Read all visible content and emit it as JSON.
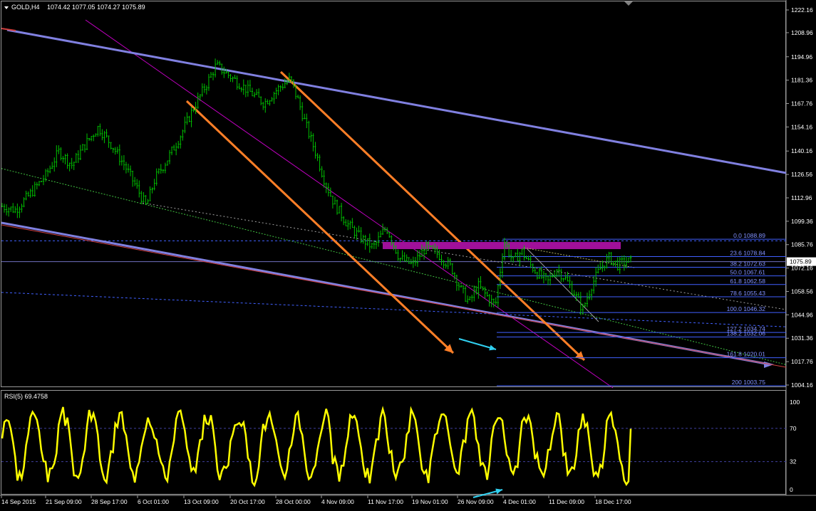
{
  "header": {
    "symbol_label": "GOLD,H4",
    "ohlc": "1074.42 1077.05 1074.27 1075.89"
  },
  "rsi": {
    "label": "RSI(5) 69.4758",
    "levels": [
      100,
      70,
      32,
      0
    ],
    "level_labels": [
      "100",
      "70",
      "32",
      "0"
    ]
  },
  "colors": {
    "background": "#000000",
    "candles": "#00c000",
    "channel": "#8080e0",
    "orange": "#ff7f27",
    "magenta": "#c000c0",
    "fib": "#4060ff",
    "rsi": "#ffff00",
    "cyan_arrow": "#30d0f0",
    "resistance_zone": "#a0109a",
    "price_label_bg": "#ffffff"
  },
  "chart_data": {
    "type": "candlestick",
    "symbol": "GOLD",
    "timeframe": "H4",
    "current_price": 1075.89,
    "current_price_label": "1075.89",
    "price_axis": [
      1222.16,
      1208.96,
      1194.96,
      1181.36,
      1167.76,
      1154.16,
      1140.16,
      1126.56,
      1112.96,
      1099.36,
      1085.76,
      1072.16,
      1058.56,
      1044.96,
      1031.36,
      1017.76,
      1004.16
    ],
    "price_axis_labels": [
      "1222.16",
      "1208.96",
      "1194.96",
      "1181.36",
      "1167.76",
      "1154.16",
      "1140.16",
      "1126.56",
      "1112.96",
      "1099.36",
      "1085.76",
      "1072.16",
      "1058.56",
      "1044.96",
      "1031.36",
      "1017.76",
      "1004.16"
    ],
    "ylim": [
      1002,
      1226
    ],
    "time_axis": [
      "14 Sep 2015",
      "21 Sep 09:00",
      "28 Sep 17:00",
      "6 Oct 01:00",
      "13 Oct 09:00",
      "20 Oct 17:00",
      "28 Oct 00:00",
      "4 Nov 09:00",
      "11 Nov 17:00",
      "19 Nov 01:00",
      "26 Nov 09:00",
      "4 Dec 01:00",
      "11 Dec 09:00",
      "18 Dec 17:00"
    ],
    "price_path": [
      [
        0,
        1108
      ],
      [
        3,
        1106
      ],
      [
        6,
        1114
      ],
      [
        10,
        1126
      ],
      [
        13,
        1140
      ],
      [
        16,
        1132
      ],
      [
        19,
        1144
      ],
      [
        22,
        1154
      ],
      [
        25,
        1144
      ],
      [
        28,
        1132
      ],
      [
        31,
        1118
      ],
      [
        33,
        1108
      ],
      [
        35,
        1124
      ],
      [
        38,
        1136
      ],
      [
        41,
        1150
      ],
      [
        44,
        1166
      ],
      [
        47,
        1180
      ],
      [
        49,
        1190
      ],
      [
        51,
        1186
      ],
      [
        54,
        1180
      ],
      [
        57,
        1174
      ],
      [
        60,
        1168
      ],
      [
        63,
        1176
      ],
      [
        66,
        1182
      ],
      [
        68,
        1168
      ],
      [
        70,
        1152
      ],
      [
        72,
        1138
      ],
      [
        74,
        1122
      ],
      [
        76,
        1110
      ],
      [
        79,
        1098
      ],
      [
        82,
        1090
      ],
      [
        85,
        1084
      ],
      [
        88,
        1096
      ],
      [
        91,
        1078
      ],
      [
        94,
        1074
      ],
      [
        97,
        1084
      ],
      [
        100,
        1080
      ],
      [
        103,
        1072
      ],
      [
        105,
        1060
      ],
      [
        107,
        1052
      ],
      [
        109,
        1062
      ],
      [
        111,
        1056
      ],
      [
        113,
        1050
      ],
      [
        115,
        1088
      ],
      [
        117,
        1076
      ],
      [
        119,
        1082
      ],
      [
        121,
        1074
      ],
      [
        123,
        1068
      ],
      [
        125,
        1064
      ],
      [
        127,
        1072
      ],
      [
        129,
        1066
      ],
      [
        131,
        1058
      ],
      [
        133,
        1048
      ],
      [
        135,
        1062
      ],
      [
        137,
        1072
      ],
      [
        139,
        1078
      ],
      [
        141,
        1074
      ],
      [
        143,
        1076
      ]
    ],
    "path_x_max": 144,
    "fib_levels": [
      {
        "label": "0.0 1088.89",
        "price": 1088.89
      },
      {
        "label": "23.6 1078.84",
        "price": 1078.84
      },
      {
        "label": "38.2 1072.63",
        "price": 1072.63
      },
      {
        "label": "50.0 1067.61",
        "price": 1067.61
      },
      {
        "label": "61.8 1062.58",
        "price": 1062.58
      },
      {
        "label": "78.6 1055.43",
        "price": 1055.43
      },
      {
        "label": "100.0 1046.32",
        "price": 1046.32
      },
      {
        "label": "127.2 1034.74",
        "price": 1034.74
      },
      {
        "label": "138.2 1032.06",
        "price": 1032.06
      },
      {
        "label": "161.8 1020.01",
        "price": 1020.01
      },
      {
        "label": "200 1003.75",
        "price": 1003.75
      }
    ],
    "rsi_period": 5,
    "rsi_value": 69.4758
  }
}
